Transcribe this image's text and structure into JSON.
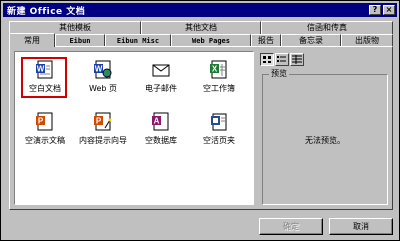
{
  "window": {
    "title": "新建 Office 文档",
    "help_label": "?",
    "close_label": "×"
  },
  "tabs_row1": [
    "其他模板",
    "其他文档",
    "信函和传真"
  ],
  "tabs_row2": [
    "常用",
    "Eibun",
    "Eibun Misc",
    "Web Pages",
    "报告",
    "备忘录",
    "出版物"
  ],
  "items": [
    {
      "label": "空白文档",
      "icon": "word-doc-icon"
    },
    {
      "label": "Web 页",
      "icon": "web-page-icon"
    },
    {
      "label": "电子邮件",
      "icon": "email-icon"
    },
    {
      "label": "空工作簿",
      "icon": "excel-workbook-icon"
    },
    {
      "label": "空演示文稿",
      "icon": "ppt-blank-icon"
    },
    {
      "label": "内容提示向导",
      "icon": "ppt-wizard-icon"
    },
    {
      "label": "空数据库",
      "icon": "access-db-icon"
    },
    {
      "label": "空活页夹",
      "icon": "binder-icon"
    }
  ],
  "selected_index": 0,
  "preview": {
    "legend": "预览",
    "message": "无法预览。"
  },
  "buttons": {
    "ok": "确定",
    "cancel": "取消"
  },
  "view_buttons": [
    "large-icons-icon",
    "list-icon",
    "details-icon"
  ]
}
